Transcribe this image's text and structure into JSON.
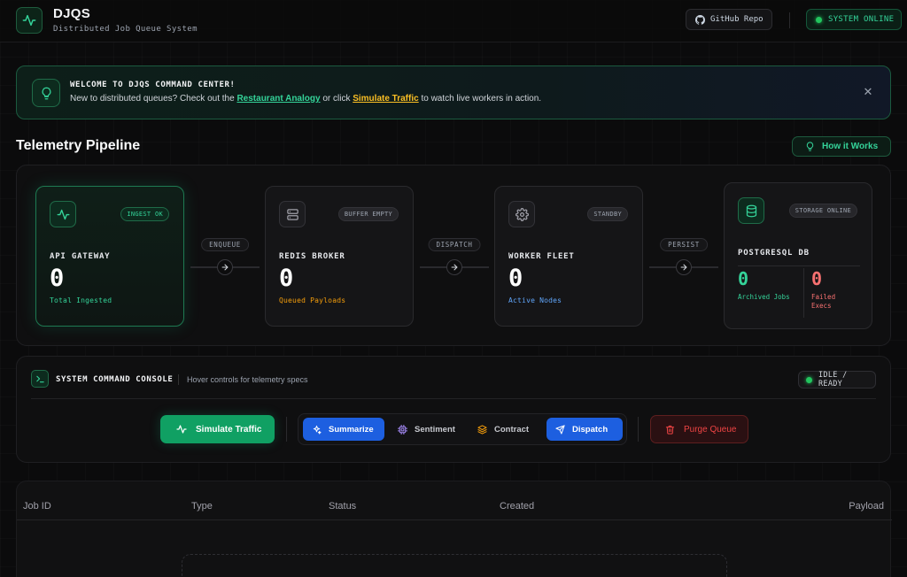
{
  "header": {
    "title": "DJQS",
    "subtitle": "Distributed Job Queue System",
    "github_label": "GitHub Repo",
    "status_label": "SYSTEM ONLINE"
  },
  "banner": {
    "title": "WELCOME TO DJQS COMMAND CENTER!",
    "text_before": "New to distributed queues? Check out the ",
    "link_analogy": "Restaurant Analogy",
    "text_middle": " or click ",
    "link_simulate": "Simulate Traffic",
    "text_after": " to watch live workers in action."
  },
  "pipeline": {
    "title": "Telemetry Pipeline",
    "how_label": "How it Works",
    "nodes": [
      {
        "label": "API GATEWAY",
        "badge": "INGEST OK",
        "value": "0",
        "sub": "Total Ingested",
        "sub_color": "#34d399"
      },
      {
        "label": "REDIS BROKER",
        "badge": "BUFFER EMPTY",
        "value": "0",
        "sub": "Queued Payloads",
        "sub_color": "#f59e0b"
      },
      {
        "label": "WORKER FLEET",
        "badge": "STANDBY",
        "value": "0",
        "sub": "Active Nodes",
        "sub_color": "#60a5fa"
      },
      {
        "label": "POSTGRESQL DB",
        "badge": "STORAGE ONLINE",
        "archived_value": "0",
        "archived_label": "Archived Jobs",
        "failed_value": "0",
        "failed_label": "Failed Execs"
      }
    ],
    "connectors": [
      "ENQUEUE",
      "DISPATCH",
      "PERSIST"
    ]
  },
  "console": {
    "title": "SYSTEM COMMAND CONSOLE",
    "hint": "Hover controls for telemetry specs",
    "status": "IDLE / READY",
    "simulate_label": "Simulate Traffic",
    "job_buttons": [
      "Summarize",
      "Sentiment",
      "Contract",
      "Dispatch"
    ],
    "purge_label": "Purge Queue"
  },
  "table": {
    "columns": [
      "Job ID",
      "Type",
      "Status",
      "Created",
      "Payload"
    ]
  }
}
